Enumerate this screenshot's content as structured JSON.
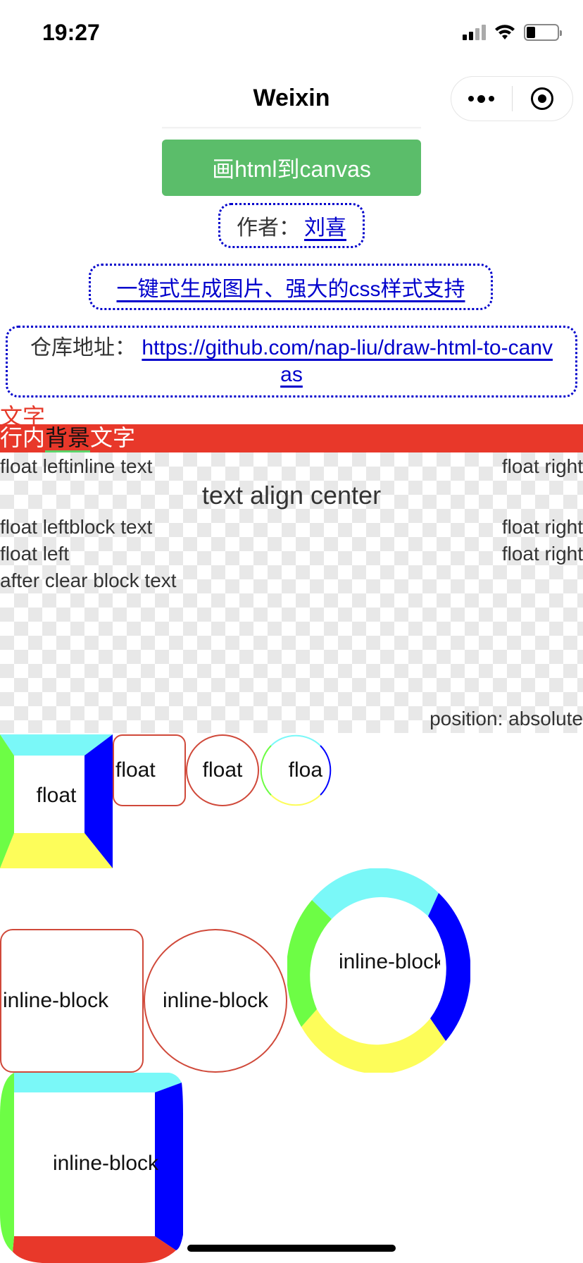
{
  "status_bar": {
    "time": "19:27"
  },
  "nav": {
    "title": "Weixin"
  },
  "draw_button": "画html到canvas",
  "author": {
    "label": "作者：",
    "name": "刘喜"
  },
  "feature_link": "一键式生成图片、强大的css样式支持",
  "repo": {
    "label": "仓库地址：",
    "url": "https://github.com/nap-liu/draw-html-to-canvas"
  },
  "red_text": "文字",
  "inline_bg": {
    "prefix": "行内",
    "bg_word": "背景",
    "suffix": "文字"
  },
  "checker": {
    "float_left_1": "float left",
    "inline_text": "inline text",
    "float_right_1": "float right",
    "center_text": "text align center",
    "float_left_2": "float left",
    "block_text": "block text",
    "float_right_2": "float right",
    "float_left_3": "float left",
    "float_right_3": "float right",
    "after_clear": "after clear block text",
    "absolute_text": "position: absolute"
  },
  "floats": [
    "float",
    "float",
    "float",
    "float"
  ],
  "inline_blocks": [
    "inline-block",
    "inline-block",
    "inline-block",
    "inline-block"
  ],
  "colors": {
    "green_button": "#5bbd6a",
    "link_blue": "#0000cc",
    "red": "#e8382a",
    "cyan": "#7af8f8",
    "blue": "#0000ff",
    "yellow": "#fdfd5a",
    "lime": "#6dfd45"
  }
}
